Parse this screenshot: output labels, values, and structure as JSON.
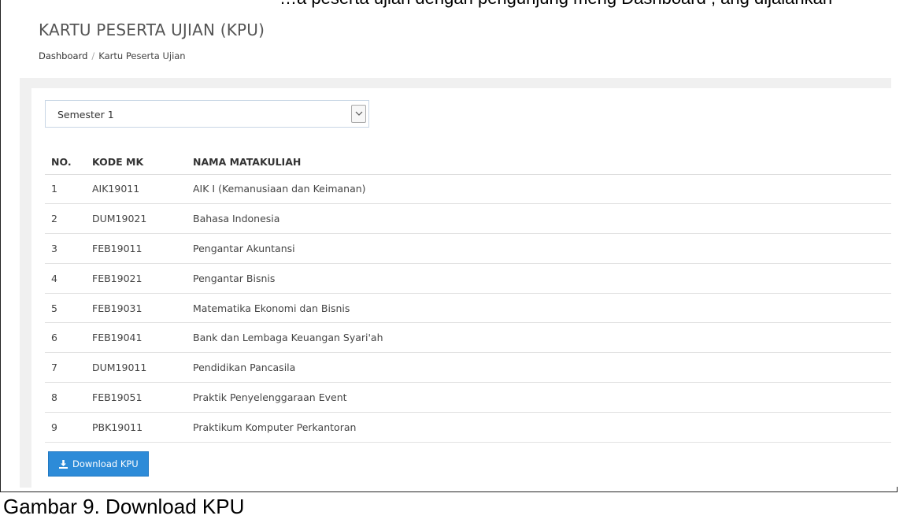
{
  "doc": {
    "top_cut_text": "…a peserta ujian dengan pengunjung meng Dashboard , ang dijalankan",
    "caption": "Gambar 9. Download KPU"
  },
  "header": {
    "title": "KARTU PESERTA UJIAN (KPU)",
    "breadcrumb": [
      "Dashboard",
      "Kartu Peserta Ujian"
    ]
  },
  "filter": {
    "semester_selected": "Semester 1"
  },
  "table": {
    "columns": [
      "NO.",
      "KODE MK",
      "NAMA MATAKULIAH"
    ],
    "rows": [
      [
        "1",
        "AIK19011",
        "AIK I (Kemanusiaan dan Keimanan)"
      ],
      [
        "2",
        "DUM19021",
        "Bahasa Indonesia"
      ],
      [
        "3",
        "FEB19011",
        "Pengantar Akuntansi"
      ],
      [
        "4",
        "FEB19021",
        "Pengantar Bisnis"
      ],
      [
        "5",
        "FEB19031",
        "Matematika Ekonomi dan Bisnis"
      ],
      [
        "6",
        "FEB19041",
        "Bank dan Lembaga Keuangan Syari'ah"
      ],
      [
        "7",
        "DUM19011",
        "Pendidikan Pancasila"
      ],
      [
        "8",
        "FEB19051",
        "Praktik Penyelenggaraan Event"
      ],
      [
        "9",
        "PBK19011",
        "Praktikum Komputer Perkantoran"
      ]
    ]
  },
  "actions": {
    "download_label": "Download KPU",
    "download_icon": "download-icon"
  },
  "colors": {
    "button": "#2d8bd8",
    "select_border": "#c8d6e5",
    "band": "#f0f0f0"
  }
}
